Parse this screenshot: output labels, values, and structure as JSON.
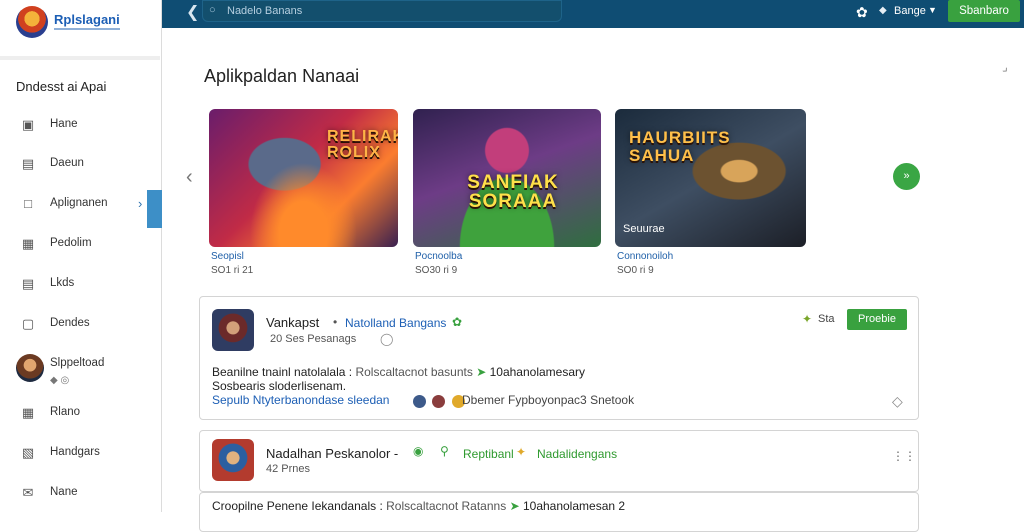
{
  "brand": {
    "name": "Rplslagani",
    "logo_icon": "brand-logo-icon"
  },
  "topbar": {
    "search_placeholder": "Nadelo Banans",
    "language": "Bange",
    "cta_label": "Sbanbaro",
    "accent": "#0f4d73",
    "button_color": "#39a13f"
  },
  "sidebar": {
    "heading": "Dndesst ai Apai",
    "items": [
      {
        "label": "Hane",
        "icon": "home-icon"
      },
      {
        "label": "Daeun",
        "icon": "calendar-icon"
      },
      {
        "label": "Aplignanen",
        "icon": "square-icon"
      },
      {
        "label": "Pedolim",
        "icon": "image-icon"
      },
      {
        "label": "Lkds",
        "icon": "document-icon"
      },
      {
        "label": "Dendes",
        "icon": "folder-icon"
      }
    ],
    "profile": {
      "name": "Slppeltoad",
      "dots": "◆ ◎"
    },
    "items_bottom": [
      {
        "label": "Rlano",
        "icon": "image-icon"
      },
      {
        "label": "Handgars",
        "icon": "message-icon"
      },
      {
        "label": "Nane",
        "icon": "mail-icon"
      }
    ]
  },
  "main": {
    "section_title": "Aplikpaldan Nanaai",
    "games": [
      {
        "art_title": "Relirak Rolix",
        "label": "Seopisl",
        "meta": "SO1 ri 21"
      },
      {
        "art_title": "Sanfiak Soraaa",
        "label": "Pocnoolba",
        "meta": "SO30 ri 9"
      },
      {
        "art_title": "Haurbiits Sahua",
        "label": "Connonoiloh",
        "meta": "SO0 ri 9",
        "badge": "Seuurae"
      }
    ]
  },
  "posts": [
    {
      "name": "Vankapst",
      "tag": "Natolland Bangans",
      "sub": "20 Ses Pesanags",
      "score": "Sta",
      "button": "Proebie",
      "body_bold": "Beanilne tnainl natolalala :",
      "body_muted": "Rolscaltacnot basunts",
      "body_tail": "10ahanolamesary",
      "body2": "Sosbearis sloderlisenam.",
      "link": "Sepulb Ntyterbanondase sleedan",
      "reply": "Dbemer Fypboyonpac3 Snetook"
    },
    {
      "name": "Nadalhan Peskanolor -",
      "tag": "Reptibanl",
      "tag2": "Nadalidengans",
      "sub": "42 Prnes"
    },
    {
      "body_bold": "Croopilne Penene Iekandanals :",
      "body_muted": "Rolscaltacnot Ratanns",
      "body_tail": "10ahanolamesan 2"
    }
  ]
}
